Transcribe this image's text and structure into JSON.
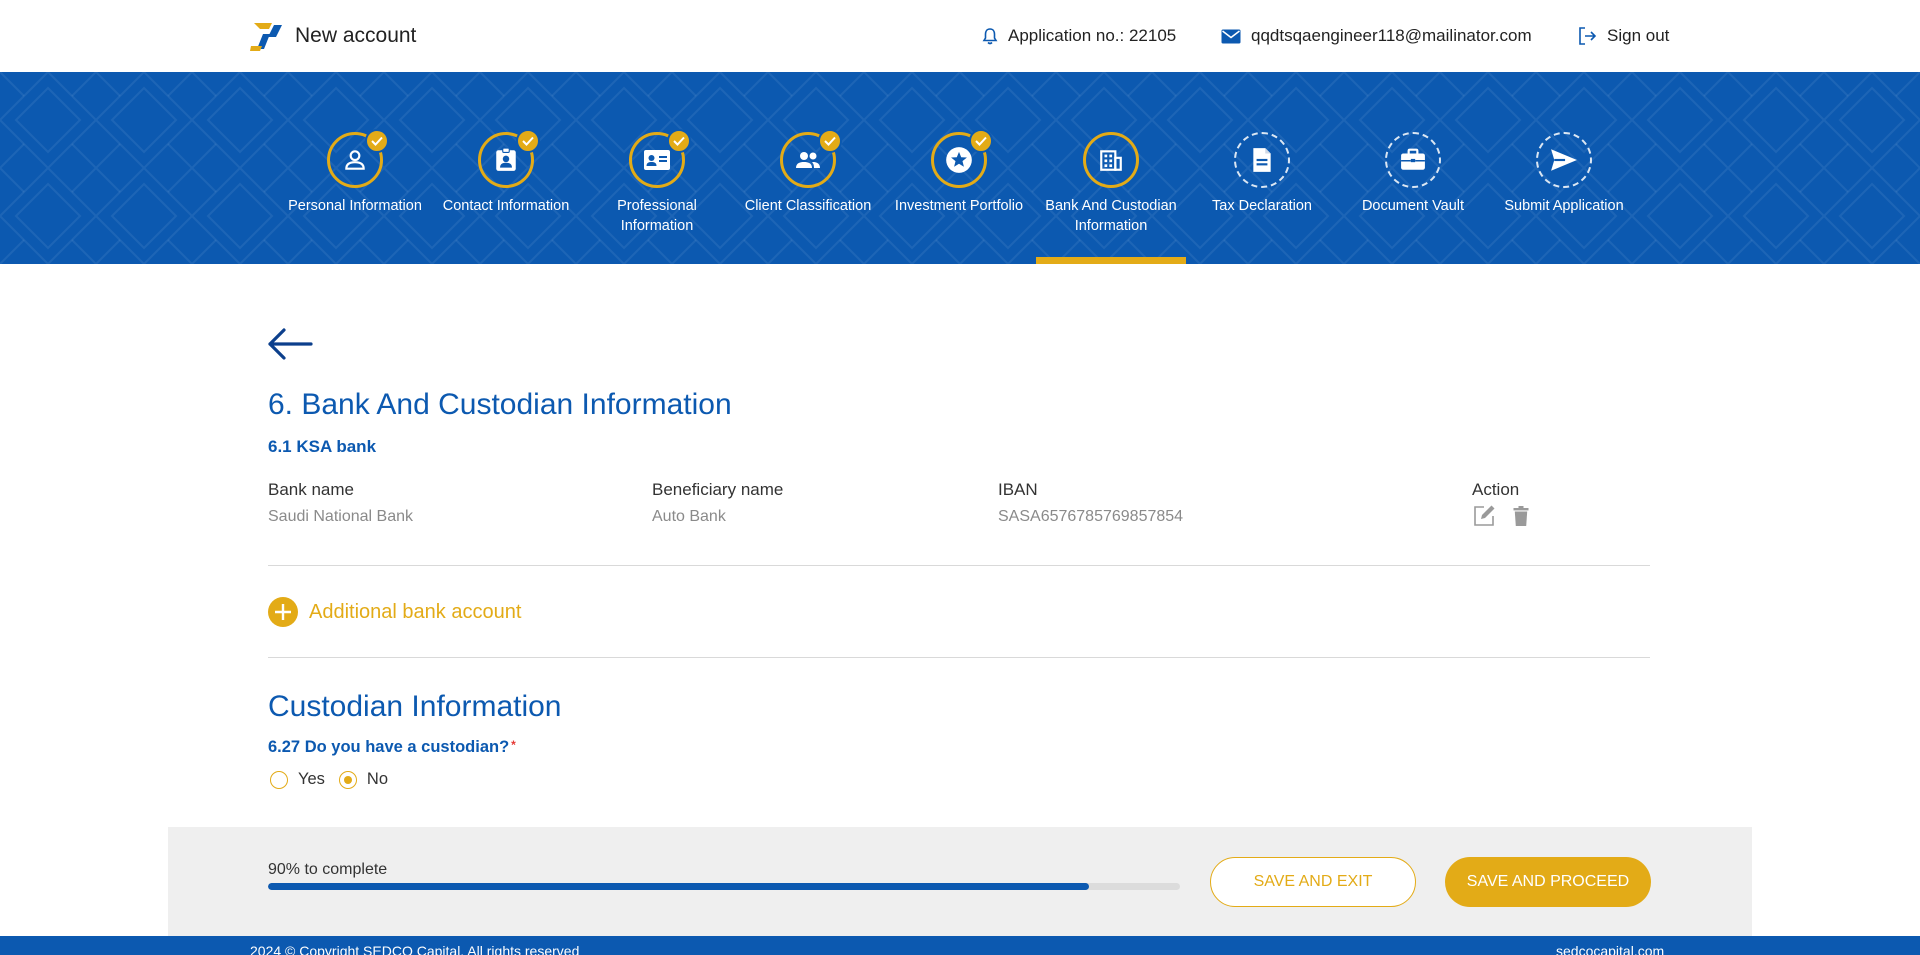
{
  "header": {
    "title": "New account",
    "application_no": "Application no.: 22105",
    "email": "qqdtsqaengineer118@mailinator.com",
    "sign_out": "Sign out"
  },
  "steps": [
    {
      "label": "Personal Information",
      "icon": "person-icon",
      "status": "completed"
    },
    {
      "label": "Contact Information",
      "icon": "contact-badge-icon",
      "status": "completed"
    },
    {
      "label": "Professional Information",
      "icon": "id-card-icon",
      "status": "completed"
    },
    {
      "label": "Client Classification",
      "icon": "group-icon",
      "status": "completed"
    },
    {
      "label": "Investment Portfolio",
      "icon": "star-icon",
      "status": "completed"
    },
    {
      "label": "Bank And Custodian Information",
      "icon": "bank-building-icon",
      "status": "current"
    },
    {
      "label": "Tax Declaration",
      "icon": "document-icon",
      "status": "pending"
    },
    {
      "label": "Document Vault",
      "icon": "briefcase-icon",
      "status": "pending"
    },
    {
      "label": "Submit Application",
      "icon": "send-icon",
      "status": "pending"
    }
  ],
  "main": {
    "section_title": "6. Bank And Custodian Information",
    "subsection_title": "6.1 KSA bank",
    "table": {
      "headers": {
        "bank_name": "Bank name",
        "beneficiary_name": "Beneficiary name",
        "iban": "IBAN",
        "action": "Action"
      },
      "rows": [
        {
          "bank_name": "Saudi National Bank",
          "beneficiary_name": "Auto Bank",
          "iban": "SASA6576785769857854"
        }
      ]
    },
    "add_bank_label": "Additional bank account",
    "custodian_title": "Custodian Information",
    "custodian_question": "6.27 Do you have a custodian?",
    "required_mark": "*",
    "options": {
      "yes": "Yes",
      "no": "No",
      "selected": "no"
    }
  },
  "footer_panel": {
    "progress_percent": 90,
    "progress_label": "90% to complete",
    "save_exit": "SAVE AND EXIT",
    "save_proceed": "SAVE AND PROCEED"
  },
  "bottom": {
    "copyright": "2024 © Copyright SEDCO Capital. All rights reserved",
    "site": "sedcocapital.com"
  },
  "colors": {
    "primary": "#0c59b0",
    "accent": "#e3ab17"
  }
}
